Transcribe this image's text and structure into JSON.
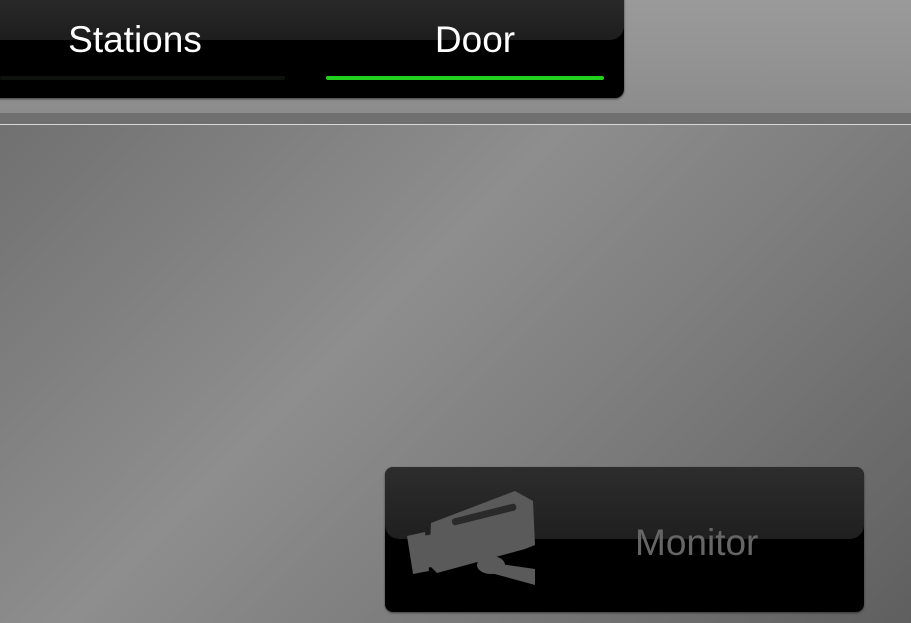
{
  "tabs": [
    {
      "label": "Stations",
      "selected": false
    },
    {
      "label": "Door",
      "selected": true
    }
  ],
  "colors": {
    "active_indicator": "#22d01e",
    "tab_text": "#ffffff",
    "monitor_text": "#666666"
  },
  "monitor_button": {
    "label": "Monitor",
    "icon": "security-camera-icon"
  }
}
